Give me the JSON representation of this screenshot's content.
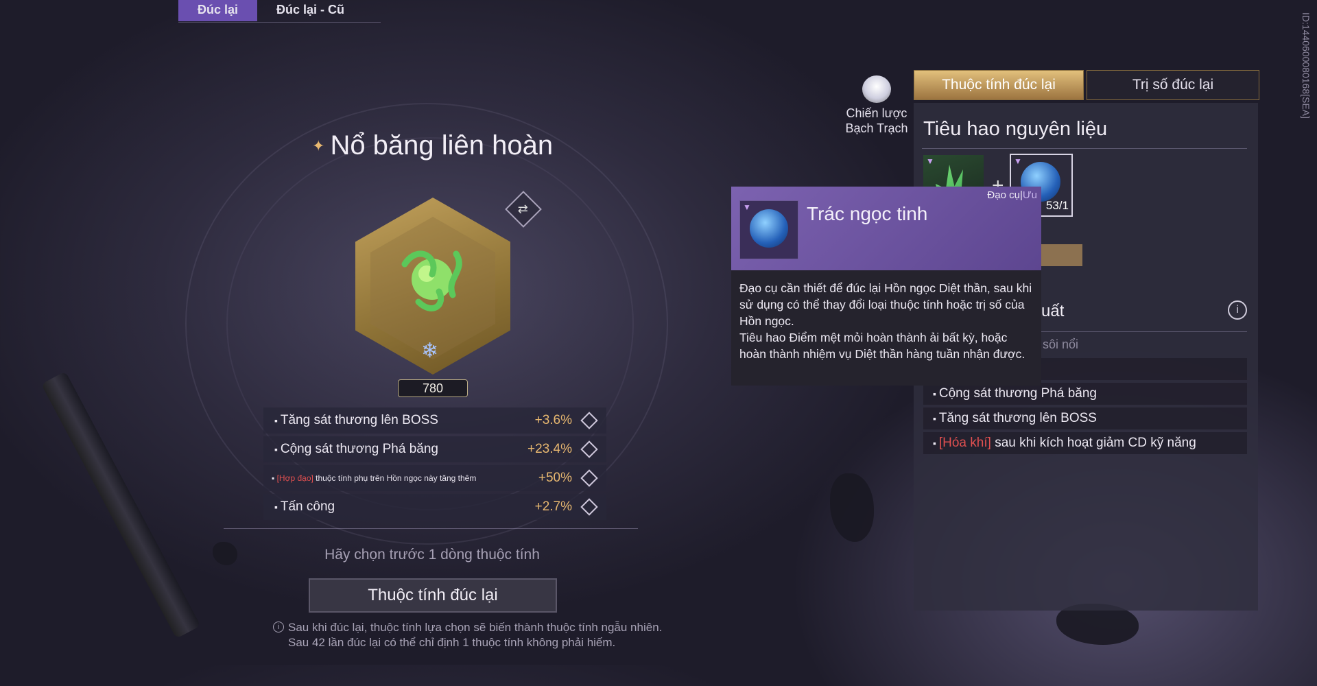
{
  "top_tabs": [
    {
      "label": "Đúc lại",
      "active": true
    },
    {
      "label": "Đúc lại - Cũ",
      "active": false
    }
  ],
  "side_id": "ID:1440600080168[SEA]",
  "item": {
    "title": "Nổ băng liên hoàn",
    "score": "780"
  },
  "stats": [
    {
      "label": "Tăng sát thương lên BOSS",
      "value": "+3.6%"
    },
    {
      "label": "Cộng sát thương Phá băng",
      "value": "+23.4%"
    },
    {
      "tag": "[Hợp đạo]",
      "label": "thuộc tính phụ trên Hồn ngọc này tăng thêm",
      "value": "+50%"
    },
    {
      "label": "Tấn công",
      "value": "+2.7%"
    }
  ],
  "hint": "Hãy chọn trước 1 dòng thuộc tính",
  "main_button": "Thuộc tính đúc lại",
  "notes": [
    "Sau khi đúc lại, thuộc tính lựa chọn sẽ biến thành thuộc tính ngẫu nhiên.",
    "Sau 42 lần đúc lại có thể chỉ định 1 thuộc tính không phải hiếm."
  ],
  "strategy": {
    "line1": "Chiến lược",
    "line2": "Bạch Trạch"
  },
  "right_tabs": [
    {
      "label": "Thuộc tính đúc lại",
      "active": true
    },
    {
      "label": "Trị số đúc lại",
      "active": false
    }
  ],
  "right_panel": {
    "title": "Tiêu hao nguyên liệu",
    "material_count": "53/1",
    "section_title_partial": "uất",
    "muted_partial": "sôi nổi",
    "rows": [
      {
        "label": "Cộng sát thương Phá băng"
      },
      {
        "label": "Tăng sát thương lên BOSS"
      },
      {
        "tag": "[Hóa khí]",
        "label": "sau khi kích hoạt giảm CD kỹ năng"
      }
    ]
  },
  "tooltip": {
    "name": "Trác ngọc tinh",
    "category": "Đạo cụ",
    "category_sub": "Ưu",
    "description_1": "Đạo cụ cần thiết để đúc lại Hồn ngọc Diệt thần, sau khi sử dụng có thể thay đổi loại thuộc tính hoặc trị số của Hồn ngọc.",
    "description_2": "Tiêu hao Điểm mệt mỏi hoàn thành ải bất kỳ, hoặc hoàn thành nhiệm vụ Diệt thần hàng tuần nhận được."
  }
}
